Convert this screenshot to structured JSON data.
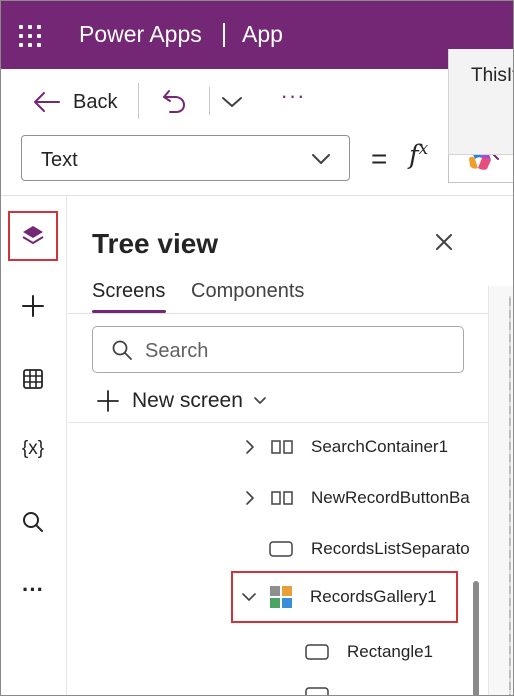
{
  "app_bar": {
    "product": "Power Apps",
    "app_name": "App"
  },
  "command_bar": {
    "back_label": "Back",
    "more_label": "···"
  },
  "formula_bar": {
    "property_value": "Text",
    "equals": "=",
    "fx_label": "f",
    "fx_sup": "x",
    "popup_text": "ThisIt"
  },
  "rail": {
    "items": [
      {
        "name": "tree-view",
        "icon": "layers-icon",
        "selected": true
      },
      {
        "name": "insert",
        "icon": "plus-icon",
        "selected": false
      },
      {
        "name": "data",
        "icon": "table-icon",
        "selected": false
      },
      {
        "name": "variables",
        "icon": "variables-icon",
        "glyph": "{x}",
        "selected": false
      },
      {
        "name": "search",
        "icon": "search-icon",
        "selected": false
      },
      {
        "name": "more",
        "icon": "more-icon",
        "glyph": "···",
        "selected": false
      }
    ]
  },
  "tree_view": {
    "title": "Tree view",
    "tabs": [
      {
        "label": "Screens",
        "active": true
      },
      {
        "label": "Components",
        "active": false
      }
    ],
    "search_placeholder": "Search",
    "new_screen_label": "New screen",
    "items": [
      {
        "label": "SearchContainer1",
        "icon": "container-icon",
        "expand": "collapsed",
        "level": 1,
        "selected": false
      },
      {
        "label": "NewRecordButtonBa",
        "icon": "container-icon",
        "expand": "collapsed",
        "level": 1,
        "selected": false
      },
      {
        "label": "RecordsListSeparato",
        "icon": "rectangle-icon",
        "expand": "none",
        "level": 1,
        "selected": false
      },
      {
        "label": "RecordsGallery1",
        "icon": "gallery-icon",
        "expand": "expanded",
        "level": 1,
        "selected": true
      },
      {
        "label": "Rectangle1",
        "icon": "rectangle-icon",
        "expand": "none",
        "level": 2,
        "selected": false
      }
    ]
  },
  "colors": {
    "brand": "#742774",
    "highlight_box": "#d13438",
    "gallery_icon": [
      "#e8a13a",
      "#4aa564",
      "#3b8fd9",
      "#8f8f8f"
    ]
  }
}
